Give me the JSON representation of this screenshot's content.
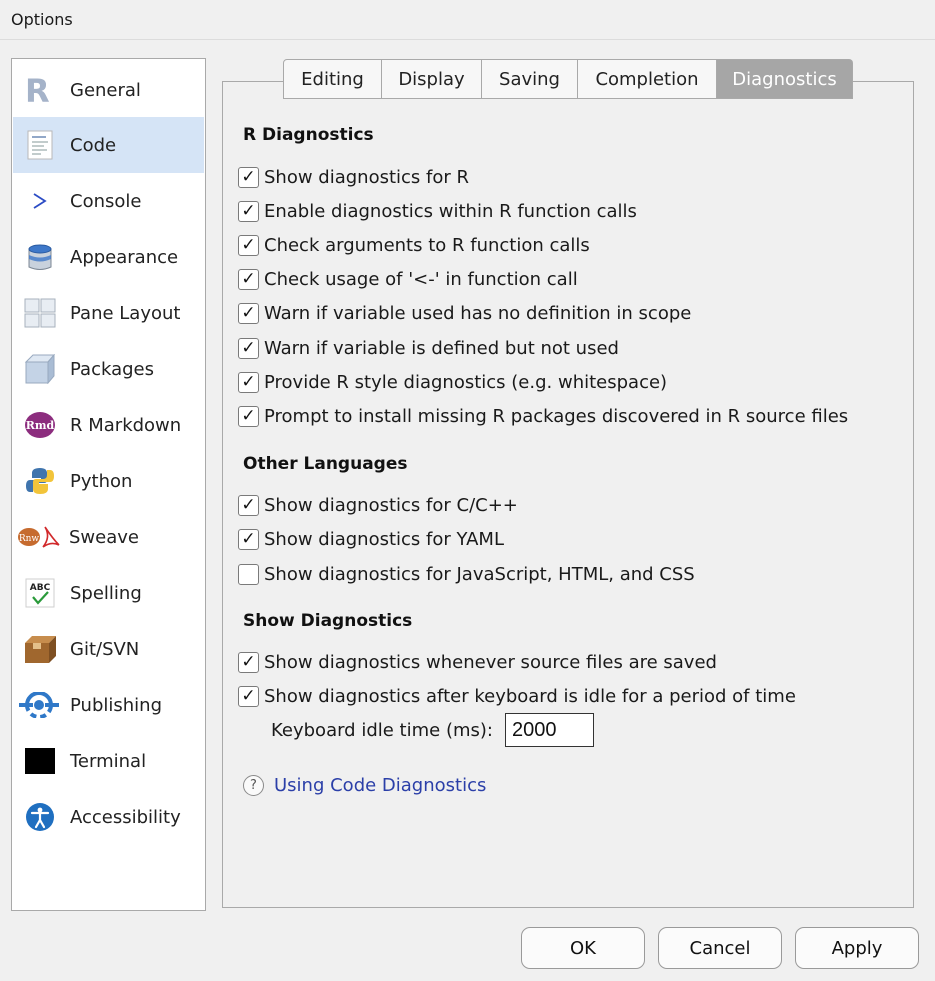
{
  "window": {
    "title": "Options"
  },
  "sidebar": {
    "items": [
      {
        "label": "General",
        "icon": "r-logo-icon"
      },
      {
        "label": "Code",
        "icon": "code-document-icon"
      },
      {
        "label": "Console",
        "icon": "console-prompt-icon"
      },
      {
        "label": "Appearance",
        "icon": "paint-bucket-icon"
      },
      {
        "label": "Pane Layout",
        "icon": "pane-layout-icon"
      },
      {
        "label": "Packages",
        "icon": "package-box-icon"
      },
      {
        "label": "R Markdown",
        "icon": "rmd-icon"
      },
      {
        "label": "Python",
        "icon": "python-icon"
      },
      {
        "label": "Sweave",
        "icon": "sweave-icon"
      },
      {
        "label": "Spelling",
        "icon": "spelling-abc-icon"
      },
      {
        "label": "Git/SVN",
        "icon": "git-box-icon"
      },
      {
        "label": "Publishing",
        "icon": "publishing-icon"
      },
      {
        "label": "Terminal",
        "icon": "terminal-icon"
      },
      {
        "label": "Accessibility",
        "icon": "accessibility-icon"
      }
    ],
    "selected": "Code"
  },
  "tabs": [
    {
      "label": "Editing"
    },
    {
      "label": "Display"
    },
    {
      "label": "Saving"
    },
    {
      "label": "Completion"
    },
    {
      "label": "Diagnostics"
    }
  ],
  "active_tab": "Diagnostics",
  "sections": {
    "r_diagnostics": {
      "title": "R Diagnostics",
      "options": [
        {
          "label": "Show diagnostics for R",
          "checked": true
        },
        {
          "label": "Enable diagnostics within R function calls",
          "checked": true
        },
        {
          "label": "Check arguments to R function calls",
          "checked": true
        },
        {
          "label": "Check usage of '<-' in function call",
          "checked": true
        },
        {
          "label": "Warn if variable used has no definition in scope",
          "checked": true
        },
        {
          "label": "Warn if variable is defined but not used",
          "checked": true
        },
        {
          "label": "Provide R style diagnostics (e.g. whitespace)",
          "checked": true
        },
        {
          "label": "Prompt to install missing R packages discovered in R source files",
          "checked": true
        }
      ]
    },
    "other_languages": {
      "title": "Other Languages",
      "options": [
        {
          "label": "Show diagnostics for C/C++",
          "checked": true
        },
        {
          "label": "Show diagnostics for YAML",
          "checked": true
        },
        {
          "label": "Show diagnostics for JavaScript, HTML, and CSS",
          "checked": false
        }
      ]
    },
    "show_diagnostics": {
      "title": "Show Diagnostics",
      "options": [
        {
          "label": "Show diagnostics whenever source files are saved",
          "checked": true
        },
        {
          "label": "Show diagnostics after keyboard is idle for a period of time",
          "checked": true
        }
      ],
      "idle_label": "Keyboard idle time (ms):",
      "idle_value": "2000"
    }
  },
  "help": {
    "icon_glyph": "?",
    "link_label": "Using Code Diagnostics"
  },
  "buttons": {
    "ok": "OK",
    "cancel": "Cancel",
    "apply": "Apply"
  },
  "check_glyph": "✓"
}
